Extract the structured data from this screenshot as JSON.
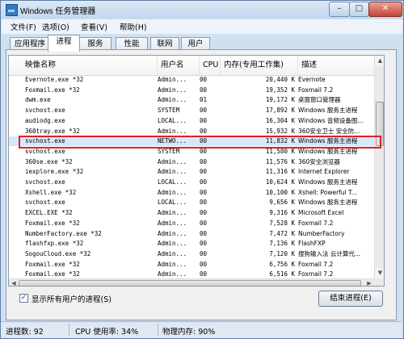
{
  "window": {
    "title": "Windows 任务管理器"
  },
  "menu": [
    "文件(F)",
    "选项(O)",
    "查看(V)",
    "帮助(H)"
  ],
  "tabs": [
    "应用程序",
    "进程",
    "服务",
    "性能",
    "联网",
    "用户"
  ],
  "active_tab": "进程",
  "columns": [
    "映像名称",
    "用户名",
    "CPU",
    "内存(专用工作集)",
    "描述"
  ],
  "processes": [
    {
      "name": "Evernote.exe *32",
      "user": "Admin...",
      "cpu": "00",
      "mem": "20,440 K",
      "desc": "Evernote"
    },
    {
      "name": "Foxmail.exe *32",
      "user": "Admin...",
      "cpu": "00",
      "mem": "19,352 K",
      "desc": "Foxmail 7.2"
    },
    {
      "name": "dwm.exe",
      "user": "Admin...",
      "cpu": "01",
      "mem": "19,172 K",
      "desc": "桌面窗口管理器"
    },
    {
      "name": "svchost.exe",
      "user": "SYSTEM",
      "cpu": "00",
      "mem": "17,892 K",
      "desc": "Windows 服务主进程"
    },
    {
      "name": "audiodg.exe",
      "user": "LOCAL...",
      "cpu": "00",
      "mem": "16,304 K",
      "desc": "Windows 音频设备图..."
    },
    {
      "name": "360tray.exe *32",
      "user": "Admin...",
      "cpu": "00",
      "mem": "15,932 K",
      "desc": "360安全卫士 安全防..."
    },
    {
      "name": "svchost.exe",
      "user": "NETWO...",
      "cpu": "00",
      "mem": "11,832 K",
      "desc": "Windows 服务主进程"
    },
    {
      "name": "svchost.exe",
      "user": "SYSTEM",
      "cpu": "00",
      "mem": "11,580 K",
      "desc": "Windows 服务主进程"
    },
    {
      "name": "360se.exe *32",
      "user": "Admin...",
      "cpu": "00",
      "mem": "11,576 K",
      "desc": "360安全浏览器"
    },
    {
      "name": "iexplore.exe *32",
      "user": "Admin...",
      "cpu": "00",
      "mem": "11,316 K",
      "desc": "Internet Explorer"
    },
    {
      "name": "svchost.exe",
      "user": "LOCAL...",
      "cpu": "00",
      "mem": "10,624 K",
      "desc": "Windows 服务主进程"
    },
    {
      "name": "Xshell.exe *32",
      "user": "Admin...",
      "cpu": "00",
      "mem": "10,100 K",
      "desc": "Xshell: Powerful T..."
    },
    {
      "name": "svchost.exe",
      "user": "LOCAL...",
      "cpu": "00",
      "mem": "9,656 K",
      "desc": "Windows 服务主进程"
    },
    {
      "name": "EXCEL.EXE *32",
      "user": "Admin...",
      "cpu": "00",
      "mem": "9,316 K",
      "desc": "Microsoft Excel"
    },
    {
      "name": "Foxmail.exe *32",
      "user": "Admin...",
      "cpu": "00",
      "mem": "7,528 K",
      "desc": "Foxmail 7.2"
    },
    {
      "name": "NumberFactory.exe *32",
      "user": "Admin...",
      "cpu": "00",
      "mem": "7,472 K",
      "desc": "NumberFactory"
    },
    {
      "name": "flashfxp.exe *32",
      "user": "Admin...",
      "cpu": "00",
      "mem": "7,136 K",
      "desc": "FlashFXP"
    },
    {
      "name": "SogouCloud.exe *32",
      "user": "Admin...",
      "cpu": "00",
      "mem": "7,120 K",
      "desc": "搜狗输入法 云计算代..."
    },
    {
      "name": "Foxmail.exe *32",
      "user": "Admin...",
      "cpu": "00",
      "mem": "6,756 K",
      "desc": "Foxmail 7.2"
    },
    {
      "name": "Foxmail.exe *32",
      "user": "Admin...",
      "cpu": "00",
      "mem": "6,516 K",
      "desc": "Foxmail 7.2"
    }
  ],
  "selected_index": 6,
  "show_all_users": {
    "label": "显示所有用户的进程(S)",
    "checked": "✓"
  },
  "end_process_button": "结束进程(E)",
  "status": {
    "processes": "进程数: 92",
    "cpu": "CPU 使用率: 34%",
    "memory": "物理内存: 90%"
  }
}
